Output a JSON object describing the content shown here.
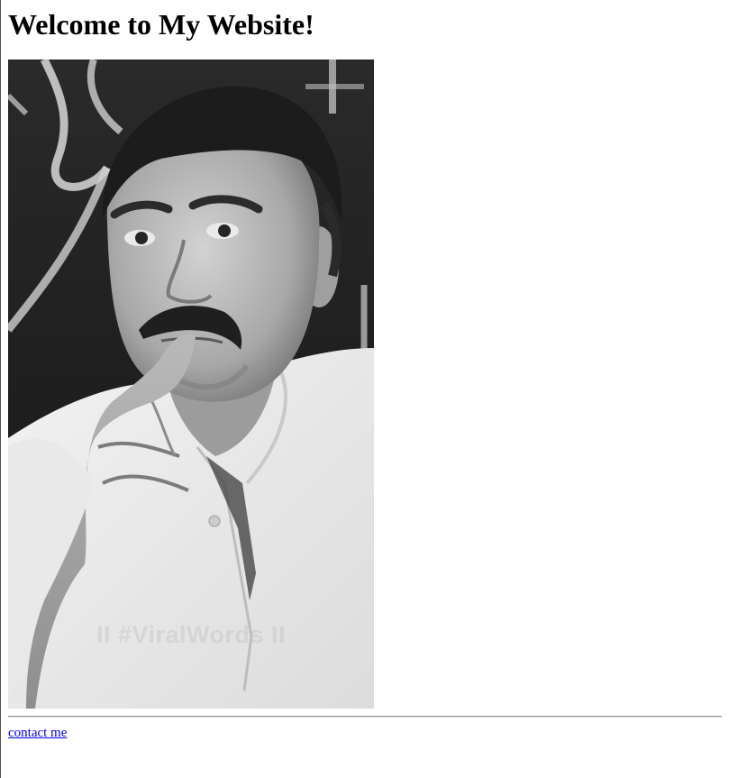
{
  "page": {
    "heading": "Welcome to My Website!"
  },
  "photo": {
    "description_icon": "portrait-photo",
    "watermark": "II #ViralWords II"
  },
  "footer": {
    "link_label": "contact me"
  },
  "colors": {
    "link": "#0000ee",
    "text": "#000000",
    "background": "#ffffff"
  }
}
